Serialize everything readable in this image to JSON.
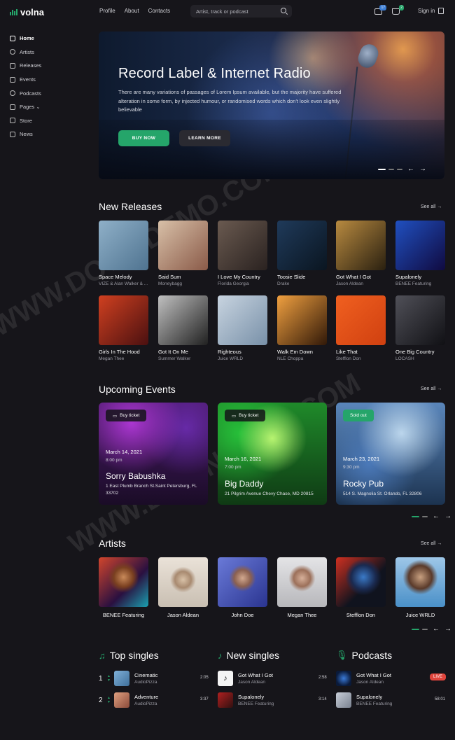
{
  "header": {
    "logo": "volna",
    "nav": [
      "Profile",
      "About",
      "Contacts"
    ],
    "search_placeholder": "Artist, track or podcast",
    "mail_count": "17",
    "cart_count": "2",
    "signin_label": "Sign in"
  },
  "sidebar": {
    "items": [
      {
        "label": "Home",
        "icon": "home-icon"
      },
      {
        "label": "Artists",
        "icon": "users-icon"
      },
      {
        "label": "Releases",
        "icon": "music-note-icon"
      },
      {
        "label": "Events",
        "icon": "calendar-icon"
      },
      {
        "label": "Podcasts",
        "icon": "microphone-icon"
      },
      {
        "label": "Pages ⌄",
        "icon": "files-icon"
      },
      {
        "label": "Store",
        "icon": "store-icon"
      },
      {
        "label": "News",
        "icon": "news-icon"
      }
    ]
  },
  "hero": {
    "title": "Record Label & Internet Radio",
    "text": "There are many variations of passages of Lorem Ipsum available, but the majority have suffered alteration in some form, by injected humour, or randomised words which don't look even slightly believable",
    "buy_label": "BUY NOW",
    "learn_label": "LEARN MORE"
  },
  "releases": {
    "title": "New Releases",
    "see_all": "See all",
    "items": [
      {
        "title": "Space Melody",
        "artist": "VIZE & Alan Walker & ..."
      },
      {
        "title": "Said Sum",
        "artist": "Moneybagg"
      },
      {
        "title": "I Love My Country",
        "artist": "Florida Georgia"
      },
      {
        "title": "Toosie Slide",
        "artist": "Drake"
      },
      {
        "title": "Got What I Got",
        "artist": "Jason Aldean"
      },
      {
        "title": "Supalonely",
        "artist": "BENEE Featuring"
      },
      {
        "title": "Girls In The Hood",
        "artist": "Megan Thee"
      },
      {
        "title": "Got It On Me",
        "artist": "Summer Walker"
      },
      {
        "title": "Righteous",
        "artist": "Juice WRLD"
      },
      {
        "title": "Walk Em Down",
        "artist": "NLE Choppa"
      },
      {
        "title": "Like That",
        "artist": "Stefflon Don"
      },
      {
        "title": "One Big Country",
        "artist": "LOCASH"
      }
    ]
  },
  "events": {
    "title": "Upcoming Events",
    "see_all": "See all",
    "items": [
      {
        "tag": "Buy ticket",
        "date": "March 14, 2021",
        "time": "8:00 pm",
        "name": "Sorry Babushka",
        "address": "1 East Plumb Branch St.Saint Petersburg, FL 33702"
      },
      {
        "tag": "Buy ticket",
        "date": "March 16, 2021",
        "time": "7:00 pm",
        "name": "Big Daddy",
        "address": "21 Pilgrim Avenue Chevy Chase, MD 20815"
      },
      {
        "tag": "Sold out",
        "date": "March 23, 2021",
        "time": "9:30 pm",
        "name": "Rocky Pub",
        "address": "514 S. Magnolia St. Orlando, FL 32806"
      }
    ]
  },
  "artists": {
    "title": "Artists",
    "see_all": "See all",
    "items": [
      "BENEE Featuring",
      "Jason Aldean",
      "John Doe",
      "Megan Thee",
      "Stefflon Don",
      "Juice WRLD"
    ]
  },
  "top_singles": {
    "title": "Top singles",
    "items": [
      {
        "num": "1",
        "title": "Cinematic",
        "artist": "AudioPizza",
        "duration": "2:05"
      },
      {
        "num": "2",
        "title": "Adventure",
        "artist": "AudioPizza",
        "duration": "3:37"
      }
    ]
  },
  "new_singles": {
    "title": "New singles",
    "items": [
      {
        "title": "Got What I Got",
        "artist": "Jason Aldean",
        "duration": "2:58"
      },
      {
        "title": "Supalonely",
        "artist": "BENEE Featuring",
        "duration": "3:14"
      }
    ]
  },
  "podcasts": {
    "title": "Podcasts",
    "items": [
      {
        "title": "Got What I Got",
        "artist": "Jason Aldean",
        "badge": "LIVE"
      },
      {
        "title": "Supalonely",
        "artist": "BENEE Featuring",
        "duration": "58:01"
      }
    ]
  },
  "watermark": "WWW.DOWNDEMO.COM",
  "colors": {
    "accent": "#25a56a",
    "background": "#16151a",
    "live": "#e0453c"
  }
}
